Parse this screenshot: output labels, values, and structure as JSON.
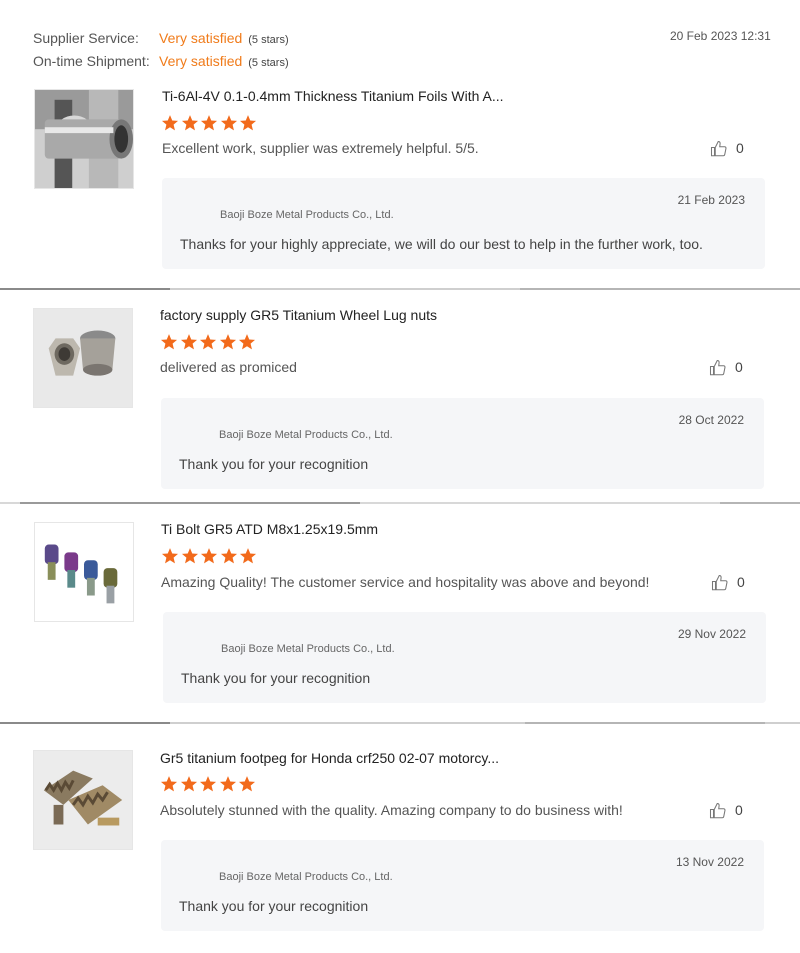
{
  "header": {
    "supplier_service_label": "Supplier Service:",
    "supplier_service_value": "Very satisfied",
    "supplier_service_note": "(5 stars)",
    "ontime_label": "On-time Shipment:",
    "ontime_value": "Very satisfied",
    "ontime_note": "(5 stars)",
    "date": "20 Feb 2023 12:31"
  },
  "colors": {
    "accent": "#f07b1a",
    "star": "#f26a1b",
    "reply_bg": "#f5f6f8"
  },
  "reviews": [
    {
      "image_icon": "titanium-tube-image",
      "product_title": "Ti-6Al-4V 0.1-0.4mm Thickness Titanium Foils With A...",
      "rating": 5,
      "comment": "Excellent work, supplier was extremely helpful. 5/5.",
      "likes": "0",
      "reply": {
        "date": "21 Feb 2023",
        "company": "Baoji Boze Metal Products Co., Ltd.",
        "text": "Thanks for your highly appreciate, we will do our best to help in the further work, too."
      }
    },
    {
      "image_icon": "lug-nuts-image",
      "product_title": "factory supply GR5 Titanium Wheel Lug nuts",
      "rating": 5,
      "comment": "delivered as promiced",
      "likes": "0",
      "reply": {
        "date": "28 Oct 2022",
        "company": "Baoji Boze Metal Products Co., Ltd.",
        "text": "Thank you for your recognition"
      }
    },
    {
      "image_icon": "bolts-image",
      "product_title": "Ti Bolt GR5 ATD M8x1.25x19.5mm",
      "rating": 5,
      "comment": "Amazing Quality! The customer service and hospitality was above and beyond!",
      "likes": "0",
      "reply": {
        "date": "29 Nov 2022",
        "company": "Baoji Boze Metal Products Co., Ltd.",
        "text": "Thank you for your recognition"
      }
    },
    {
      "image_icon": "footpeg-image",
      "product_title": "Gr5 titanium footpeg for Honda crf250 02-07 motorcy...",
      "rating": 5,
      "comment": "Absolutely stunned with the quality. Amazing company to do business with!",
      "likes": "0",
      "reply": {
        "date": "13 Nov 2022",
        "company": "Baoji Boze Metal Products Co., Ltd.",
        "text": "Thank you for your recognition"
      }
    }
  ]
}
